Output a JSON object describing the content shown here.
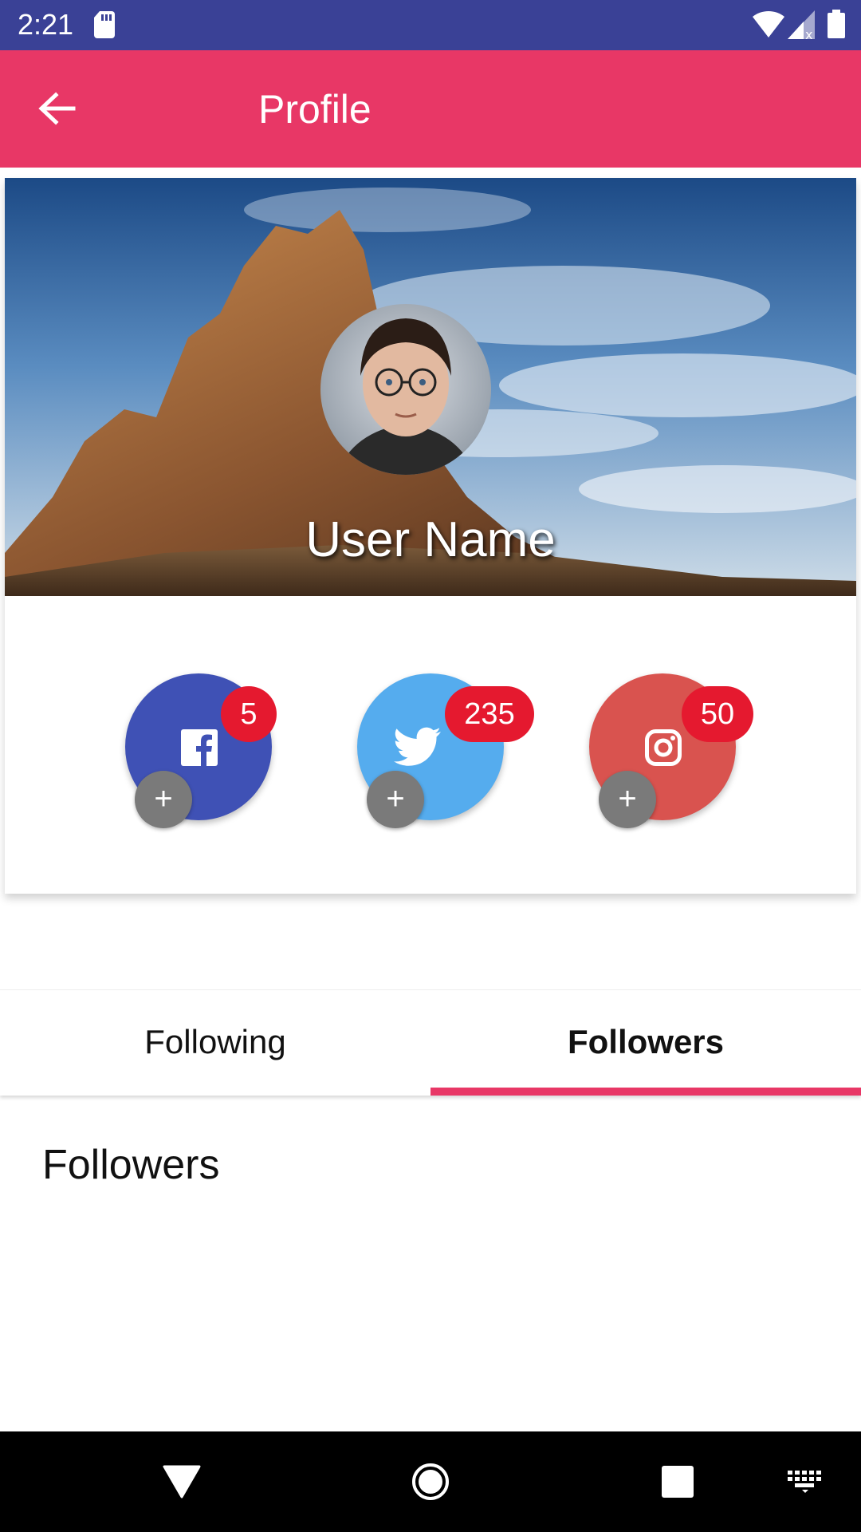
{
  "status_bar": {
    "time": "2:21",
    "icons": [
      "sd-card-icon",
      "wifi-icon",
      "signal-icon",
      "battery-icon"
    ]
  },
  "app_bar": {
    "title": "Profile",
    "back_icon": "arrow-back-icon"
  },
  "profile": {
    "user_name": "User Name"
  },
  "social": [
    {
      "network": "facebook",
      "icon": "facebook-icon",
      "count": "5",
      "color": "#3f51b5"
    },
    {
      "network": "twitter",
      "icon": "twitter-icon",
      "count": "235",
      "color": "#55acee"
    },
    {
      "network": "instagram",
      "icon": "instagram-icon",
      "count": "50",
      "color": "#d9534f"
    }
  ],
  "social_add_label": "+",
  "tabs": [
    {
      "label": "Following",
      "active": false
    },
    {
      "label": "Followers",
      "active": true
    }
  ],
  "content": {
    "title": "Followers"
  },
  "colors": {
    "status_bar": "#3a4196",
    "accent": "#e83766",
    "badge": "#e5192f"
  }
}
